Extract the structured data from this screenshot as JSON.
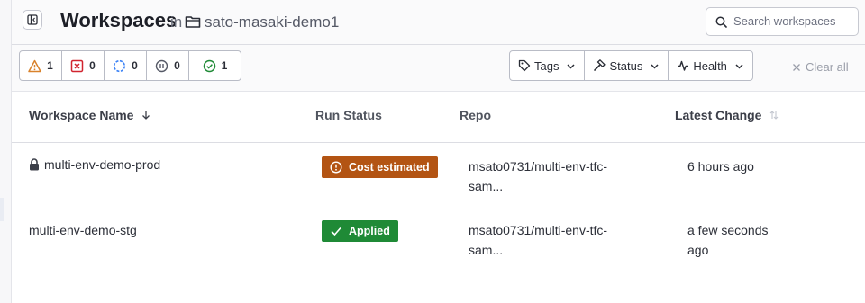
{
  "header": {
    "title": "Workspaces",
    "in_label": "in",
    "org_name": "sato-masaki-demo1"
  },
  "search": {
    "placeholder": "Search workspaces"
  },
  "status_filters": [
    {
      "icon": "warning-icon",
      "count": "1",
      "color": "#d9822b"
    },
    {
      "icon": "error-icon",
      "count": "0",
      "color": "#d1242f"
    },
    {
      "icon": "running-icon",
      "count": "0",
      "color": "#3b82f6"
    },
    {
      "icon": "paused-icon",
      "count": "0",
      "color": "#555966"
    },
    {
      "icon": "check-circle-icon",
      "count": "1",
      "color": "#1f8a36"
    }
  ],
  "filters": {
    "tags": "Tags",
    "status": "Status",
    "health": "Health",
    "clear_all": "Clear all"
  },
  "table": {
    "columns": {
      "name": "Workspace Name",
      "run_status": "Run Status",
      "repo": "Repo",
      "latest_change": "Latest Change"
    },
    "rows": [
      {
        "name": "multi-env-demo-prod",
        "locked": true,
        "run_status": "Cost estimated",
        "repo_line1": "msato0731/multi-env-tfc-",
        "repo_line2": "sam...",
        "latest_line1": "6 hours ago",
        "latest_line2": ""
      },
      {
        "name": "multi-env-demo-stg",
        "locked": false,
        "run_status": "Applied",
        "repo_line1": "msato0731/multi-env-tfc-",
        "repo_line2": "sam...",
        "latest_line1": "a few seconds",
        "latest_line2": "ago"
      }
    ]
  },
  "colors": {
    "cost_estimated": "#b35413",
    "applied": "#1f8a36"
  }
}
